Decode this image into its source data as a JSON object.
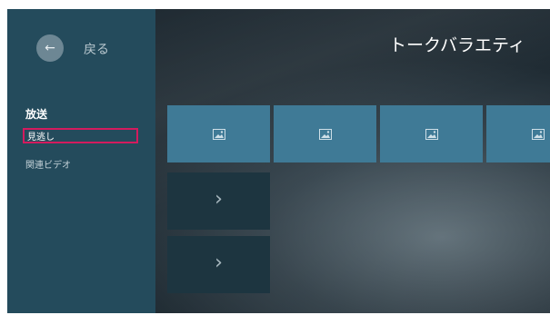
{
  "back": {
    "label": "戻る",
    "icon": "arrow-left-icon"
  },
  "nav": {
    "heading": "放送",
    "items": [
      "見逃し",
      "関連ビデオ"
    ]
  },
  "main": {
    "title": "トークバラエティ",
    "tile_icon": "image-placeholder-icon",
    "more_icon": "chevron-right-icon"
  },
  "colors": {
    "sidebar": "#244b5c",
    "tile": "#3f7a96",
    "focus": "#d31b5e"
  }
}
